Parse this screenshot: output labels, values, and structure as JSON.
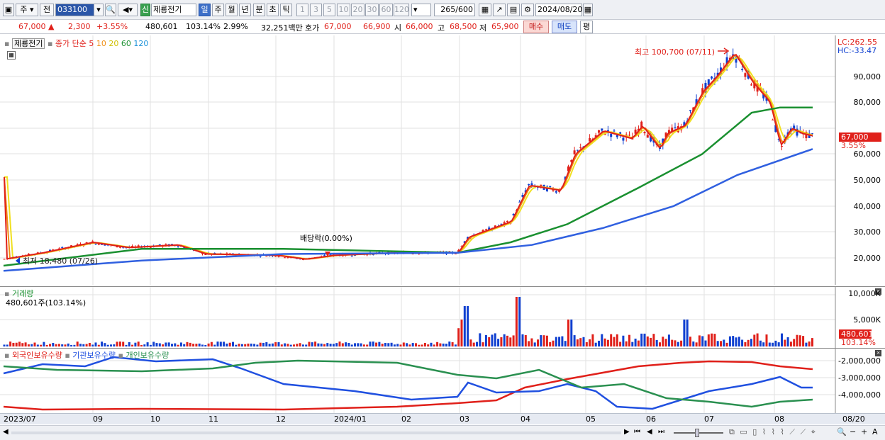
{
  "toolbar": {
    "market": "주",
    "prev_label": "전",
    "code": "033100",
    "new_badge": "신",
    "stock_name": "제룡전기",
    "period_buttons": [
      "일",
      "주",
      "월",
      "년",
      "분",
      "초",
      "틱"
    ],
    "interval_buttons": [
      "1",
      "3",
      "5",
      "10",
      "20",
      "30",
      "60",
      "120"
    ],
    "count": "265",
    "count_total": "/600",
    "date": "2024/08/20"
  },
  "quote": {
    "price": "67,000",
    "change": "2,300",
    "change_pct": "+3.55%",
    "volume": "480,601",
    "volume_ratio": "103.14%",
    "turnover": "2.99%",
    "amount": "32,251백만",
    "ask_label": "호가",
    "ask": "67,000",
    "bid": "66,900",
    "open_label": "시",
    "open": "66,000",
    "high_label": "고",
    "high": "68,500",
    "low_label": "저",
    "low": "65,900",
    "buy_label": "매수",
    "sell_label": "매도",
    "eval_label": "평"
  },
  "price_panel": {
    "name": "제룡전기",
    "ma_label": "종가 단순",
    "ma_periods": [
      {
        "label": "5",
        "color": "#e0201a"
      },
      {
        "label": "10",
        "color": "#f09018"
      },
      {
        "label": "20",
        "color": "#e0d800"
      },
      {
        "label": "60",
        "color": "#1a9030"
      },
      {
        "label": "120",
        "color": "#1890d8"
      }
    ],
    "lc": "LC:262.55",
    "hc": "HC:-33.47",
    "high_annot": "최고 100,700 (07/11)",
    "low_annot": "최저 18,480 (07/26)",
    "dividend_annot": "배당락(0.00%)",
    "last_price_tag": "67,000",
    "last_pct_tag": "3.55%",
    "y_ticks": [
      "90,000",
      "80,000",
      "70,000",
      "60,000",
      "50,000",
      "40,000",
      "30,000",
      "20,000"
    ]
  },
  "volume_panel": {
    "title": "거래량",
    "value": "480,601주(103.14%)",
    "y_ticks": [
      "10,000K",
      "5,000K"
    ],
    "last_tag": "480,601",
    "last_pct": "103.14%"
  },
  "holdings_panel": {
    "series": [
      {
        "name": "외국인보유수량",
        "color": "#e0201a"
      },
      {
        "name": "기관보유수량",
        "color": "#2050e0"
      },
      {
        "name": "개인보유수량",
        "color": "#2a9050"
      }
    ],
    "y_ticks": [
      "-2,000,000",
      "-3,000,000",
      "-4,000,000"
    ]
  },
  "x_axis": [
    "2023/07",
    "09",
    "10",
    "11",
    "12",
    "2024/01",
    "02",
    "03",
    "04",
    "05",
    "06",
    "07",
    "08",
    "08/20"
  ],
  "colors": {
    "up": "#e0201a",
    "down": "#1040d0",
    "ma5": "#e0201a",
    "ma10": "#f09018",
    "ma20": "#f0e020",
    "ma60": "#1a9030",
    "ma120": "#3060e0"
  }
}
